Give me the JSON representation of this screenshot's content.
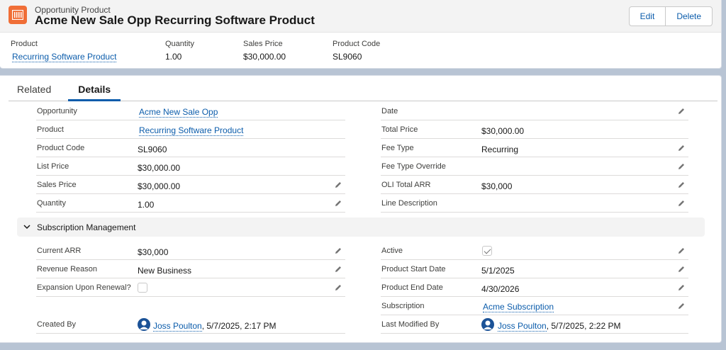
{
  "header": {
    "object_type": "Opportunity Product",
    "title": "Acme New Sale Opp Recurring Software Product",
    "edit_label": "Edit",
    "delete_label": "Delete",
    "icon": "product-icon",
    "accent_color": "#f06e37"
  },
  "highlights": [
    {
      "label": "Product",
      "value": "Recurring Software Product"
    },
    {
      "label": "Quantity",
      "value": "1.00"
    },
    {
      "label": "Sales Price",
      "value": "$30,000.00"
    },
    {
      "label": "Product Code",
      "value": "SL9060"
    }
  ],
  "tabs": [
    {
      "label": "Related"
    },
    {
      "label": "Details"
    }
  ],
  "details": {
    "left": [
      {
        "label": "Opportunity",
        "value": "Acme New Sale Opp"
      },
      {
        "label": "Product",
        "value": "Recurring Software Product"
      },
      {
        "label": "Product Code",
        "value": "SL9060"
      },
      {
        "label": "List Price",
        "value": "$30,000.00"
      },
      {
        "label": "Sales Price",
        "value": "$30,000.00"
      },
      {
        "label": "Quantity",
        "value": "1.00"
      }
    ],
    "right": [
      {
        "label": "Date",
        "value": ""
      },
      {
        "label": "Total Price",
        "value": "$30,000.00"
      },
      {
        "label": "Fee Type",
        "value": "Recurring"
      },
      {
        "label": "Fee Type Override",
        "value": ""
      },
      {
        "label": "OLI Total ARR",
        "value": "$30,000"
      },
      {
        "label": "Line Description",
        "value": ""
      }
    ]
  },
  "subscription": {
    "title": "Subscription Management",
    "left": [
      {
        "label": "Current ARR",
        "value": "$30,000"
      },
      {
        "label": "Revenue Reason",
        "value": "New Business"
      },
      {
        "label": "Expansion Upon Renewal?",
        "checked": false
      }
    ],
    "right": [
      {
        "label": "Active",
        "checked": true
      },
      {
        "label": "Product Start Date",
        "value": "5/1/2025"
      },
      {
        "label": "Product End Date",
        "value": "4/30/2026"
      },
      {
        "label": "Subscription",
        "value": "Acme Subscription"
      }
    ]
  },
  "system": {
    "created_by_label": "Created By",
    "created_by_user": "Joss Poulton",
    "created_by_date": ", 5/7/2025, 2:17 PM",
    "modified_by_label": "Last Modified By",
    "modified_by_user": "Joss Poulton",
    "modified_by_date": ", 5/7/2025, 2:22 PM"
  },
  "colors": {
    "link": "#0b5cab",
    "page_bg": "#b8c4d4"
  }
}
